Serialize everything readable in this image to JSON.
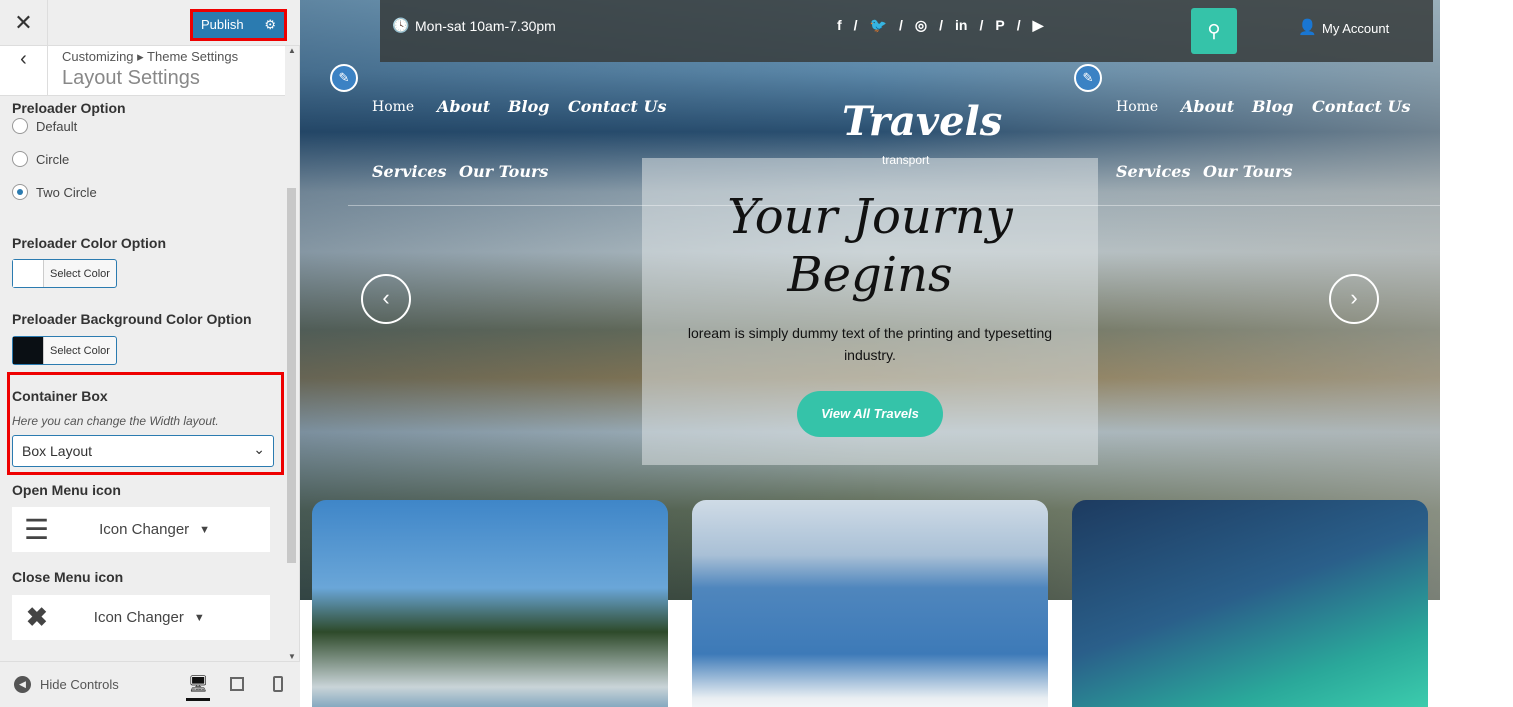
{
  "customizer": {
    "close": "✕",
    "publish": "Publish",
    "breadcrumb": "Customizing ▸ Theme Settings",
    "title": "Layout Settings",
    "preloader": {
      "label": "Preloader Option",
      "options": [
        "Default",
        "Circle",
        "Two Circle"
      ],
      "selected": "Two Circle"
    },
    "preloader_color": {
      "label": "Preloader Color Option",
      "button": "Select Color",
      "color": "#ffffff"
    },
    "preloader_bg": {
      "label": "Preloader Background Color Option",
      "button": "Select Color",
      "color": "#0a0f14"
    },
    "container": {
      "label": "Container Box",
      "description": "Here you can change the Width layout.",
      "value": "Box Layout"
    },
    "open_menu": {
      "label": "Open Menu icon",
      "button": "Icon Changer"
    },
    "close_menu": {
      "label": "Close Menu icon",
      "button": "Icon Changer"
    },
    "footer": {
      "hide": "Hide Controls"
    }
  },
  "site": {
    "hours": "Mon-sat 10am-7.30pm",
    "account": "My Account",
    "social": [
      "facebook",
      "twitter",
      "instagram",
      "linkedin",
      "pinterest",
      "youtube"
    ],
    "nav": [
      "Home",
      "About",
      "Blog",
      "Contact Us",
      "Services",
      "Our Tours"
    ],
    "brand": "Travels",
    "tagline": "transport",
    "hero": {
      "title": "Your Journy Begins",
      "text": "loream is simply dummy text of the printing and typesetting industry.",
      "button": "View All Travels"
    },
    "accent": "#35c3a9"
  }
}
